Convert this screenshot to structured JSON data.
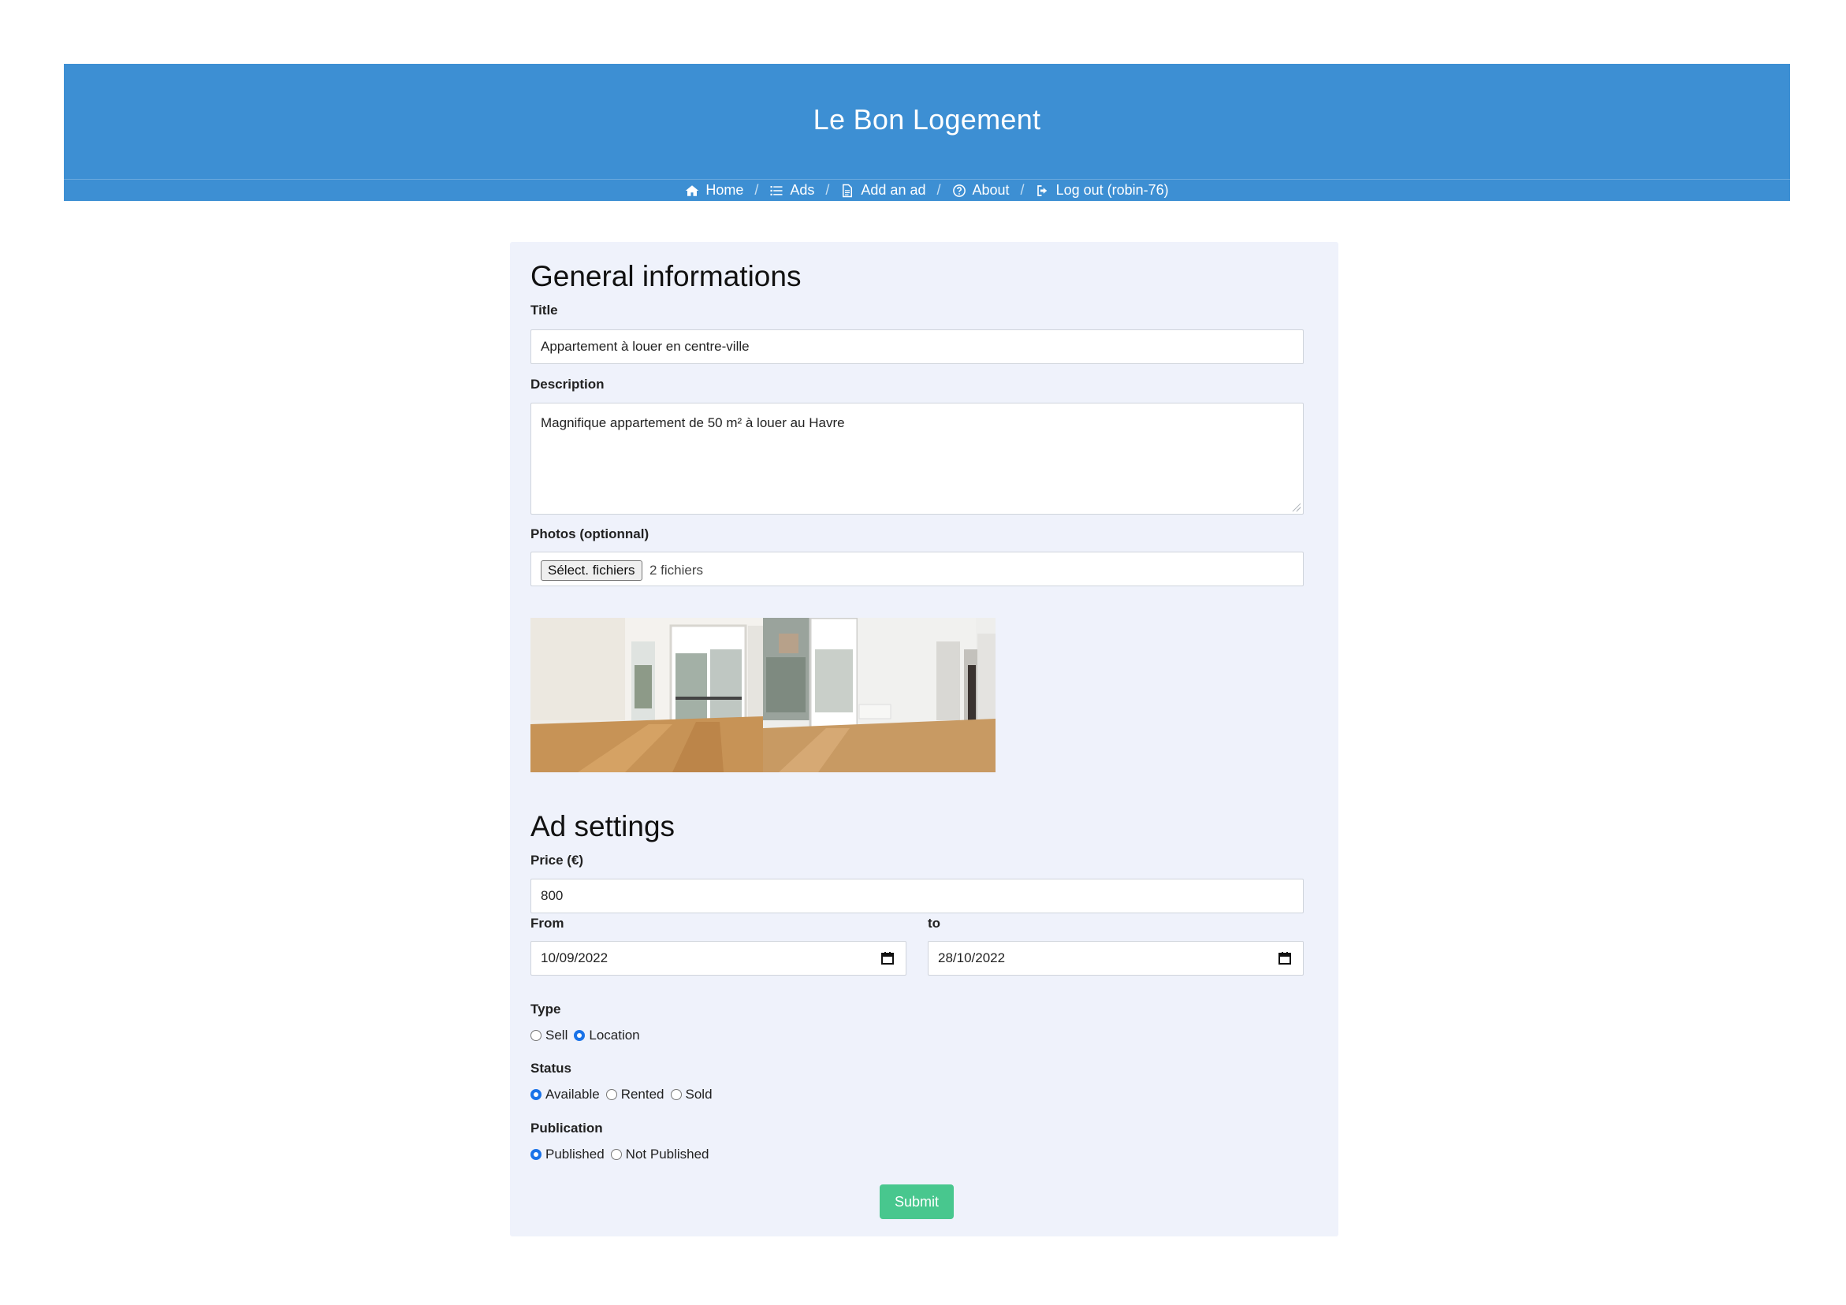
{
  "site": {
    "title": "Le Bon Logement",
    "header_color": "#3d8fd3"
  },
  "nav": {
    "items": [
      {
        "label": "Home",
        "icon": "home-icon"
      },
      {
        "label": "Ads",
        "icon": "list-icon"
      },
      {
        "label": "Add an ad",
        "icon": "file-icon"
      },
      {
        "label": "About",
        "icon": "question-circle-icon"
      },
      {
        "label": "Log out (robin-76)",
        "icon": "sign-out-icon"
      }
    ],
    "separator": "/"
  },
  "general": {
    "heading": "General informations",
    "title_label": "Title",
    "title_value": "Appartement à louer en centre-ville",
    "description_label": "Description",
    "description_value": "Magnifique appartement de 50 m² à louer au Havre",
    "photos_label": "Photos (optionnal)",
    "file_button": "Sélect. fichiers",
    "file_status": "2 fichiers"
  },
  "settings": {
    "heading": "Ad settings",
    "price_label": "Price (€)",
    "price_value": "800",
    "from_label": "From",
    "from_value": "10/09/2022",
    "to_label": "to",
    "to_value": "28/10/2022",
    "type_label": "Type",
    "type_options": [
      {
        "label": "Sell",
        "checked": false
      },
      {
        "label": "Location",
        "checked": true
      }
    ],
    "status_label": "Status",
    "status_options": [
      {
        "label": "Available",
        "checked": true
      },
      {
        "label": "Rented",
        "checked": false
      },
      {
        "label": "Sold",
        "checked": false
      }
    ],
    "publication_label": "Publication",
    "publication_options": [
      {
        "label": "Published",
        "checked": true
      },
      {
        "label": "Not Published",
        "checked": false
      }
    ]
  },
  "submit_label": "Submit",
  "colors": {
    "accent": "#48c78e",
    "card_bg": "#eff2fb",
    "radio_checked": "#1a73e8"
  }
}
